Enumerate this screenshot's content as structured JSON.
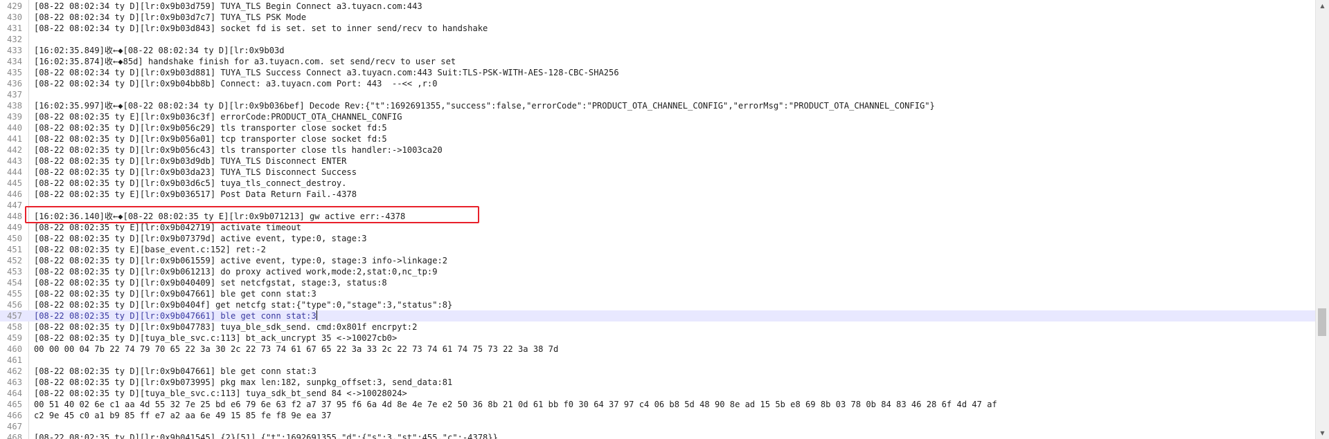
{
  "lines": [
    {
      "num": "429",
      "text": "[08-22 08:02:34 ty D][lr:0x9b03d759] TUYA_TLS Begin Connect a3.tuyacn.com:443"
    },
    {
      "num": "430",
      "text": "[08-22 08:02:34 ty D][lr:0x9b03d7c7] TUYA_TLS PSK Mode"
    },
    {
      "num": "431",
      "text": "[08-22 08:02:34 ty D][lr:0x9b03d843] socket fd is set. set to inner send/recv to handshake"
    },
    {
      "num": "432",
      "text": ""
    },
    {
      "num": "433",
      "text": "[16:02:35.849]收←◆[08-22 08:02:34 ty D][lr:0x9b03d"
    },
    {
      "num": "434",
      "text": "[16:02:35.874]收←◆85d] handshake finish for a3.tuyacn.com. set send/recv to user set"
    },
    {
      "num": "435",
      "text": "[08-22 08:02:34 ty D][lr:0x9b03d881] TUYA_TLS Success Connect a3.tuyacn.com:443 Suit:TLS-PSK-WITH-AES-128-CBC-SHA256"
    },
    {
      "num": "436",
      "text": "[08-22 08:02:34 ty D][lr:0x9b04bb8b] Connect: a3.tuyacn.com Port: 443  --<< ,r:0"
    },
    {
      "num": "437",
      "text": ""
    },
    {
      "num": "438",
      "text": "[16:02:35.997]收←◆[08-22 08:02:34 ty D][lr:0x9b036bef] Decode Rev:{\"t\":1692691355,\"success\":false,\"errorCode\":\"PRODUCT_OTA_CHANNEL_CONFIG\",\"errorMsg\":\"PRODUCT_OTA_CHANNEL_CONFIG\"}"
    },
    {
      "num": "439",
      "text": "[08-22 08:02:35 ty E][lr:0x9b036c3f] errorCode:PRODUCT_OTA_CHANNEL_CONFIG"
    },
    {
      "num": "440",
      "text": "[08-22 08:02:35 ty D][lr:0x9b056c29] tls transporter close socket fd:5"
    },
    {
      "num": "441",
      "text": "[08-22 08:02:35 ty D][lr:0x9b056a01] tcp transporter close socket fd:5"
    },
    {
      "num": "442",
      "text": "[08-22 08:02:35 ty D][lr:0x9b056c43] tls transporter close tls handler:->1003ca20"
    },
    {
      "num": "443",
      "text": "[08-22 08:02:35 ty D][lr:0x9b03d9db] TUYA_TLS Disconnect ENTER"
    },
    {
      "num": "444",
      "text": "[08-22 08:02:35 ty D][lr:0x9b03da23] TUYA_TLS Disconnect Success"
    },
    {
      "num": "445",
      "text": "[08-22 08:02:35 ty D][lr:0x9b03d6c5] tuya_tls_connect_destroy."
    },
    {
      "num": "446",
      "text": "[08-22 08:02:35 ty E][lr:0x9b036517] Post Data Return Fail.-4378"
    },
    {
      "num": "447",
      "text": ""
    },
    {
      "num": "448",
      "text": "[16:02:36.140]收←◆[08-22 08:02:35 ty E][lr:0x9b071213] gw active err:-4378"
    },
    {
      "num": "449",
      "text": "[08-22 08:02:35 ty E][lr:0x9b042719] activate timeout"
    },
    {
      "num": "450",
      "text": "[08-22 08:02:35 ty D][lr:0x9b07379d] active event, type:0, stage:3"
    },
    {
      "num": "451",
      "text": "[08-22 08:02:35 ty E][base_event.c:152] ret:-2"
    },
    {
      "num": "452",
      "text": "[08-22 08:02:35 ty D][lr:0x9b061559] active event, type:0, stage:3 info->linkage:2"
    },
    {
      "num": "453",
      "text": "[08-22 08:02:35 ty D][lr:0x9b061213] do proxy actived work,mode:2,stat:0,nc_tp:9"
    },
    {
      "num": "454",
      "text": "[08-22 08:02:35 ty D][lr:0x9b040409] set netcfgstat, stage:3, status:8"
    },
    {
      "num": "455",
      "text": "[08-22 08:02:35 ty D][lr:0x9b047661] ble get conn stat:3"
    },
    {
      "num": "456",
      "text": "[08-22 08:02:35 ty D][lr:0x9b0404f] get netcfg stat:{\"type\":0,\"stage\":3,\"status\":8}"
    },
    {
      "num": "457",
      "text": "[08-22 08:02:35 ty D][lr:0x9b047661] ble get conn stat:3"
    },
    {
      "num": "458",
      "text": "[08-22 08:02:35 ty D][lr:0x9b047783] tuya_ble_sdk_send. cmd:0x801f encrpyt:2"
    },
    {
      "num": "459",
      "text": "[08-22 08:02:35 ty D][tuya_ble_svc.c:113] bt_ack_uncrypt 35 <->10027cb0>"
    },
    {
      "num": "460",
      "text": "00 00 00 04 7b 22 74 79 70 65 22 3a 30 2c 22 73 74 61 67 65 22 3a 33 2c 22 73 74 61 74 75 73 22 3a 38 7d"
    },
    {
      "num": "461",
      "text": ""
    },
    {
      "num": "462",
      "text": "[08-22 08:02:35 ty D][lr:0x9b047661] ble get conn stat:3"
    },
    {
      "num": "463",
      "text": "[08-22 08:02:35 ty D][lr:0x9b073995] pkg max len:182, sunpkg_offset:3, send_data:81"
    },
    {
      "num": "464",
      "text": "[08-22 08:02:35 ty D][tuya_ble_svc.c:113] tuya_sdk_bt_send 84 <->10028024>"
    },
    {
      "num": "465",
      "text": "00 51 40 02 6e c1 aa 4d 55 32 7e 25 bd e6 79 6e 63 f2 a7 37 95 f6 6a 4d 8e 4e 7e e2 50 36 8b 21 0d 61 bb f0 30 64 37 97 c4 06 b8 5d 48 90 8e ad 15 5b e8 69 8b 03 78 0b 84 83 46 28 6f 4d 47 af"
    },
    {
      "num": "466",
      "text": "c2 9e 45 c0 a1 b9 85 ff e7 a2 aa 6e 49 15 85 fe f8 9e ea 37"
    },
    {
      "num": "467",
      "text": ""
    },
    {
      "num": "468",
      "text": "[08-22 08:02:35 ty D][lr:0x9b041545] {2}[51] {\"t\":1692691355,\"d\":{\"s\":3,\"st\":455,\"c\":-4378}}"
    }
  ],
  "current_line": {
    "prefix": "[08-22 08:02:35 ty D][lr:0x9b047661] ble get conn stat:3"
  },
  "scrollbar": {
    "up_arrow": "▲",
    "down_arrow": "▼"
  }
}
